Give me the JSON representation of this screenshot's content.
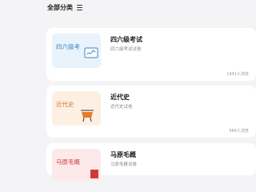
{
  "filter": {
    "label": "全部分类",
    "icon": "menu-icon"
  },
  "cards": [
    {
      "thumb_label": "四六级考",
      "title": "四六级考试",
      "subtitle": "四六级考试试卷",
      "count": "1441人浏览",
      "icon": "certificate-icon",
      "accent": "#3d86c6"
    },
    {
      "thumb_label": "近代史",
      "title": "近代史",
      "subtitle": "近代史试卷",
      "count": "666人浏览",
      "icon": "cauldron-icon",
      "accent": "#d17a2e"
    },
    {
      "thumb_label": "马原毛概",
      "title": "马原毛概",
      "subtitle": "马原毛概试卷",
      "count": "",
      "icon": "book-icon",
      "accent": "#cf3a3e"
    }
  ]
}
